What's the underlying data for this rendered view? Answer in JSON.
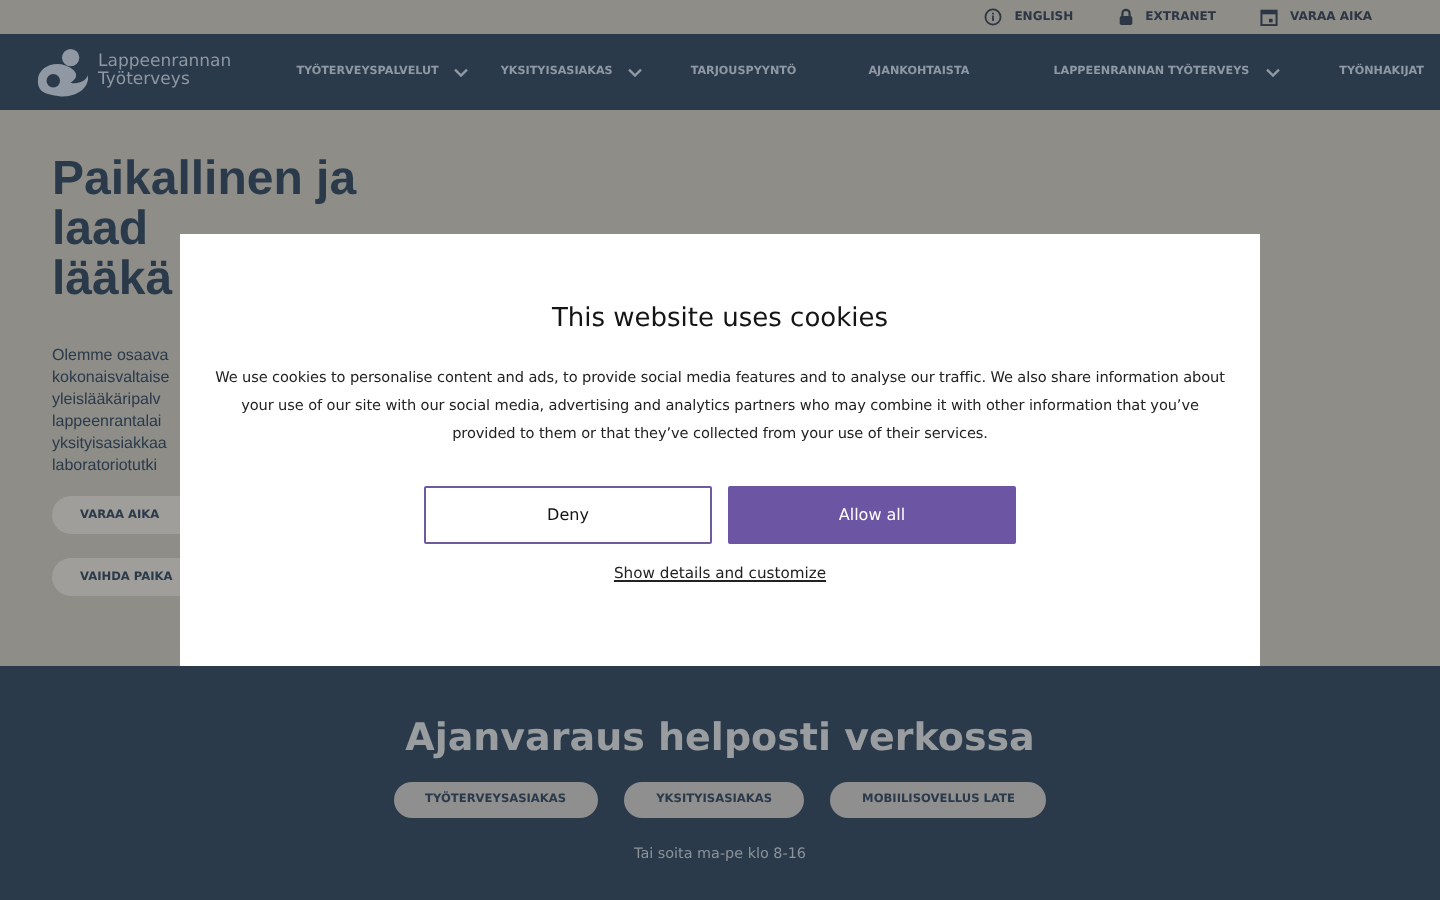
{
  "top_links": [
    {
      "label": "ENGLISH"
    },
    {
      "label": "EXTRANET"
    },
    {
      "label": "VARAA AIKA"
    }
  ],
  "logo": {
    "line1": "Lappeenrannan",
    "line2": "Työterveys"
  },
  "nav": [
    {
      "label": "TYÖTERVEYSPALVELUT",
      "kind": "dropdown"
    },
    {
      "label": "YKSITYISASIAKAS",
      "kind": "dropdown"
    },
    {
      "label": "TARJOUSPYYNTÖ",
      "kind": "link"
    },
    {
      "label": "AJANKOHTAISTA",
      "kind": "link"
    },
    {
      "label": "LAPPEENRANNAN TYÖTERVEYS",
      "kind": "dropdown"
    },
    {
      "label": "TYÖNHAKIJAT",
      "kind": "link"
    }
  ],
  "hero": {
    "title_lines": [
      "Paikallinen ja",
      "laad",
      "lääkä"
    ],
    "paragraph_lines": [
      "Olemme osaava",
      "kokonaisvaltaise",
      "yleislääkäripalv",
      "lappeenrantalai",
      "yksityisasiakkaa",
      "laboratoriotutki"
    ],
    "buttons": [
      "VARAA AIKA",
      "VAIHDA PAIKA"
    ]
  },
  "cookie_dialog": {
    "title": "This website uses cookies",
    "text": "We use cookies to personalise content and ads, to provide social media features and to analyse our traffic. We also share information about your use of our site with our social media, advertising and analytics partners who may combine it with other information that you’ve provided to them or that they’ve collected from your use of their services.",
    "buttons": [
      {
        "label": "Deny",
        "kind": "outline"
      },
      {
        "label": "Allow all",
        "kind": "filled"
      }
    ],
    "link": "Show details and customize"
  },
  "booking": {
    "title": "Ajanvaraus helposti verkossa",
    "buttons": [
      "TYÖTERVEYSASIAKAS",
      "YKSITYISASIAKAS",
      "MOBIILISOVELLUS LATE"
    ],
    "note": "Tai soita ma-pe klo 8-16"
  }
}
